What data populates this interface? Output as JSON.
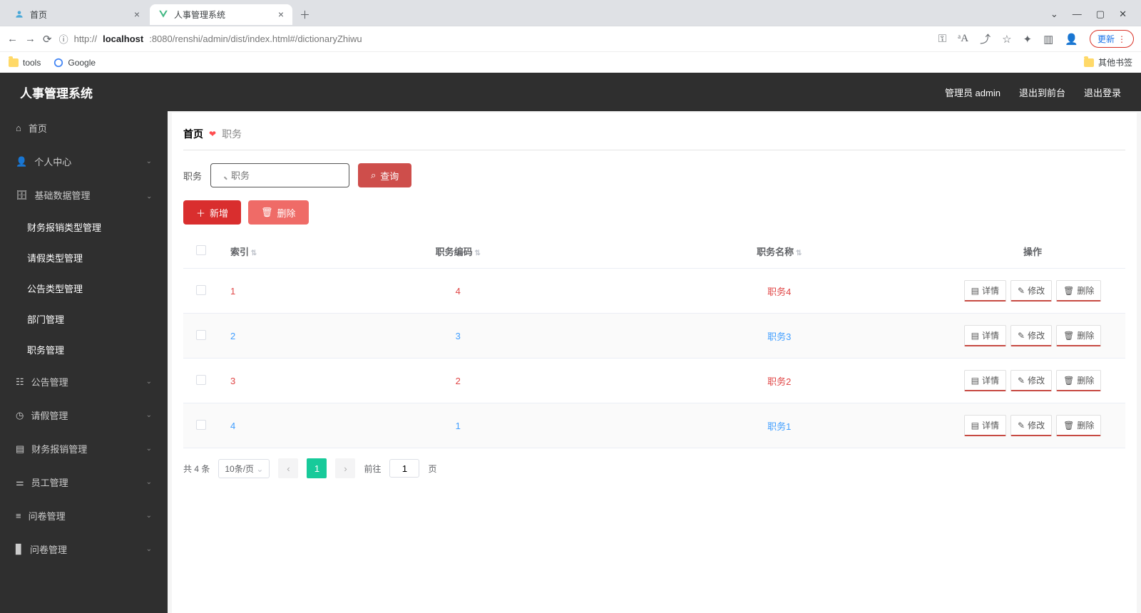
{
  "chrome": {
    "tabs": [
      {
        "title": "首页",
        "icon_color": "#4aa8d8"
      },
      {
        "title": "人事管理系统",
        "icon_color": "#41b883"
      }
    ],
    "url_prefix": "http://",
    "url_host": "localhost",
    "url_path": ":8080/renshi/admin/dist/index.html#/dictionaryZhiwu",
    "update_label": "更新",
    "bookmarks": {
      "tools": "tools",
      "google": "Google",
      "other": "其他书签"
    }
  },
  "header": {
    "app_title": "人事管理系统",
    "user_label": "管理员 admin",
    "frontend_label": "退出到前台",
    "logout_label": "退出登录"
  },
  "sidebar": {
    "home": "首页",
    "personal": "个人中心",
    "base_data": "基础数据管理",
    "sub": {
      "fin": "财务报销类型管理",
      "leave": "请假类型管理",
      "notice": "公告类型管理",
      "dept": "部门管理",
      "position": "职务管理"
    },
    "notice_mgmt": "公告管理",
    "leave_mgmt": "请假管理",
    "fin_mgmt": "财务报销管理",
    "emp_mgmt": "员工管理",
    "survey_mgmt": "问卷管理",
    "question_mgmt": "问卷管理"
  },
  "breadcrumb": {
    "home": "首页",
    "current": "职务"
  },
  "search": {
    "label": "职务",
    "placeholder": "职务",
    "btn": "查询"
  },
  "actions": {
    "add": "新增",
    "delete": "删除"
  },
  "table": {
    "headers": {
      "index": "索引",
      "code": "职务编码",
      "name": "职务名称",
      "ops": "操作"
    },
    "op_labels": {
      "detail": "详情",
      "edit": "修改",
      "delete": "删除"
    },
    "rows": [
      {
        "idx": "1",
        "code": "4",
        "name": "职务4"
      },
      {
        "idx": "2",
        "code": "3",
        "name": "职务3"
      },
      {
        "idx": "3",
        "code": "2",
        "name": "职务2"
      },
      {
        "idx": "4",
        "code": "1",
        "name": "职务1"
      }
    ]
  },
  "pager": {
    "total": "共 4 条",
    "per_page": "10条/页",
    "current": "1",
    "goto_pre": "前往",
    "goto_val": "1",
    "goto_suf": "页"
  }
}
